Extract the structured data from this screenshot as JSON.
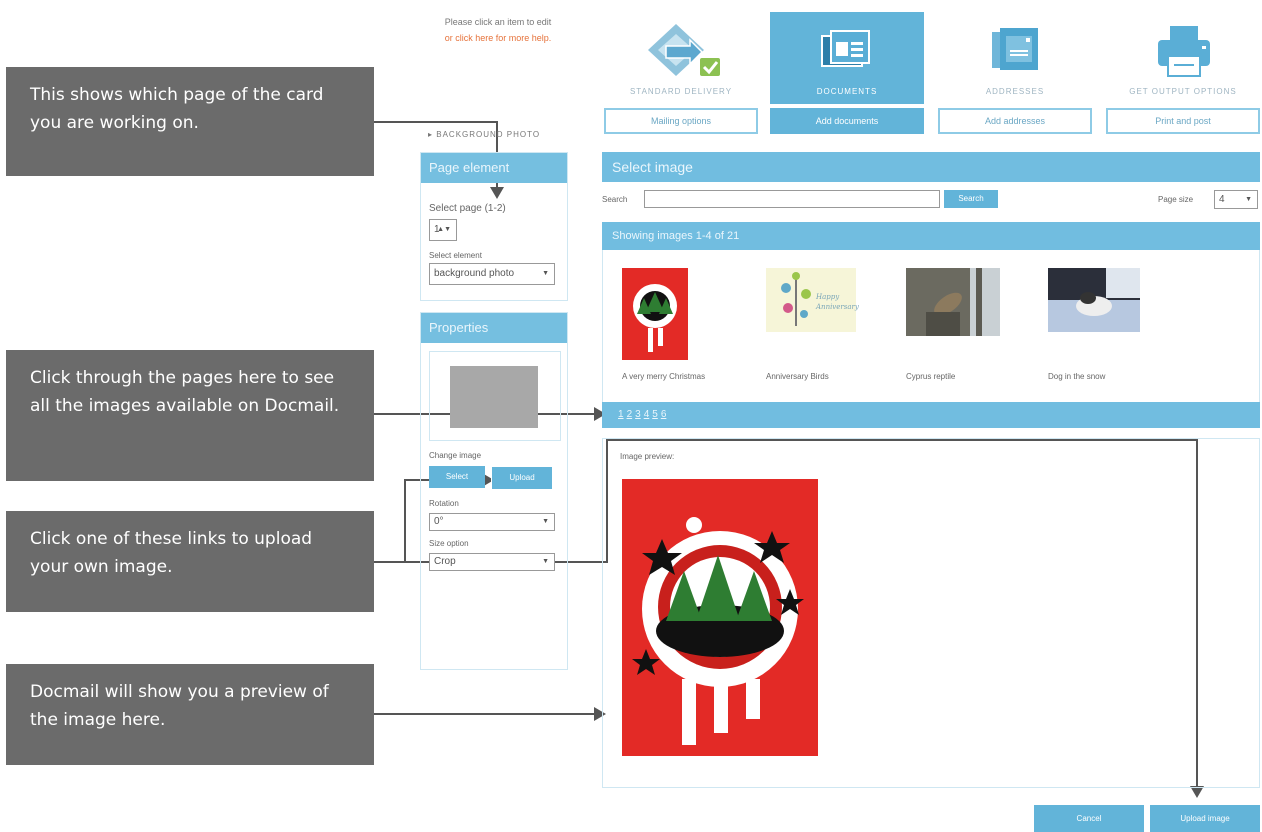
{
  "callouts": {
    "page_indicator": "This shows which page of the card you are working on.",
    "pagination": "Click through the pages here to see all the images available on Docmail.",
    "upload": "Click one of these links to upload your own image.",
    "preview": "Docmail will show you a preview of the image here."
  },
  "help": {
    "line1": "Please click an item to edit",
    "line2": "or click here for more help."
  },
  "steps": [
    {
      "label": "STANDARD DELIVERY"
    },
    {
      "label": "DOCUMENTS"
    },
    {
      "label": "ADDRESSES"
    },
    {
      "label": "GET OUTPUT OPTIONS"
    }
  ],
  "tabs": [
    "Mailing options",
    "Add documents",
    "Add addresses",
    "Print and post"
  ],
  "left": {
    "crumb": "▸ BACKGROUND PHOTO",
    "page_element_title": "Page element",
    "select_page_label": "Select page (1-2)",
    "page_value": "1",
    "select_element_label": "Select element",
    "element_value": "background photo",
    "properties_title": "Properties",
    "change_image_label": "Change image",
    "select_btn": "Select",
    "upload_btn": "Upload",
    "rotation_label": "Rotation",
    "rotation_value": "0°",
    "size_label": "Size option",
    "size_value": "Crop"
  },
  "main": {
    "title": "Select image",
    "search_label": "Search",
    "search_value": "",
    "search_btn": "Search",
    "page_size_label": "Page size",
    "page_size_value": "4",
    "showing": "Showing images 1-4 of 21",
    "images": [
      {
        "caption": "A very merry Christmas"
      },
      {
        "caption": "Anniversary Birds"
      },
      {
        "caption": "Cyprus reptile"
      },
      {
        "caption": "Dog in the snow"
      }
    ],
    "pages": [
      "1",
      "2",
      "3",
      "4",
      "5",
      "6"
    ],
    "preview_label": "Image preview:",
    "anniv_text": "Happy Anniversary"
  },
  "buttons": {
    "cancel": "Cancel",
    "upload_image": "Upload image"
  },
  "colors": {
    "accent": "#62b4d9",
    "callout": "#6b6b6b",
    "help_link": "#e6733c",
    "card_red": "#e32a26"
  }
}
